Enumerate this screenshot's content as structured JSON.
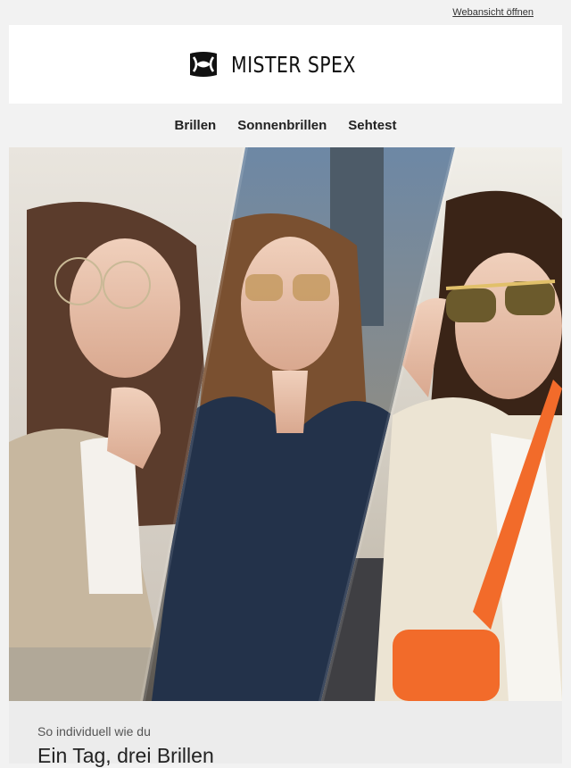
{
  "topbar": {
    "webview_link": "Webansicht öffnen"
  },
  "brand": {
    "name": "MISTER SPEX",
    "color": "#111111"
  },
  "nav": {
    "items": [
      {
        "label": "Brillen"
      },
      {
        "label": "Sonnenbrillen"
      },
      {
        "label": "Sehtest"
      }
    ]
  },
  "hero": {
    "accent_color": "#f26b2a",
    "icon": "hero-photo-three-women-glasses"
  },
  "content": {
    "eyebrow": "So individuell wie du",
    "headline": "Ein Tag, drei Brillen"
  }
}
